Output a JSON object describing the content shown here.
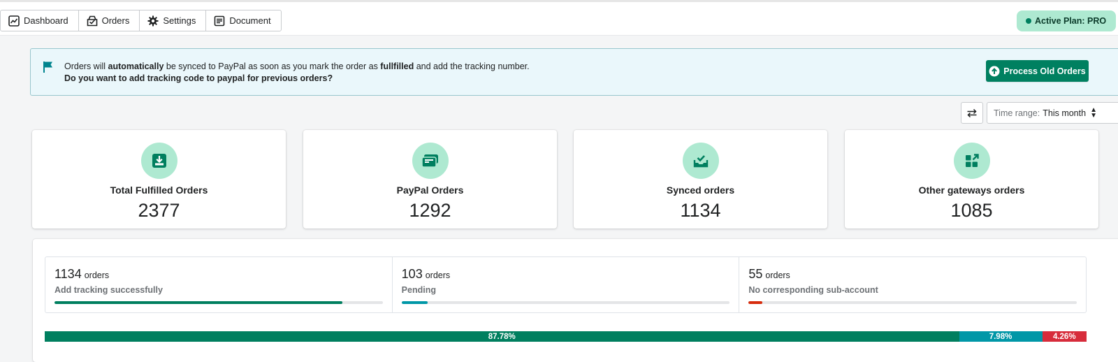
{
  "nav": {
    "items": [
      {
        "label": "Dashboard",
        "icon": "dashboard-icon"
      },
      {
        "label": "Orders",
        "icon": "orders-icon"
      },
      {
        "label": "Settings",
        "icon": "gear-icon"
      },
      {
        "label": "Document",
        "icon": "document-icon"
      }
    ]
  },
  "plan": {
    "label": "Active Plan: PRO"
  },
  "banner": {
    "line1_pre": "Orders will ",
    "line1_b1": "automatically",
    "line1_mid": " be synced to PayPal as soon as you mark the order as ",
    "line1_b2": "fullfilled",
    "line1_post": " and add the tracking number.",
    "line2": "Do you want to add tracking code to paypal for previous orders?",
    "button_label": "Process Old Orders"
  },
  "filters": {
    "time_range_label": "Time range:",
    "time_range_value": "This month"
  },
  "cards": [
    {
      "title": "Total Fulfilled Orders",
      "value": "2377",
      "icon": "download-tray-icon"
    },
    {
      "title": "PayPal Orders",
      "value": "1292",
      "icon": "paypal-card-icon"
    },
    {
      "title": "Synced orders",
      "value": "1134",
      "icon": "synced-tray-icon"
    },
    {
      "title": "Other gateways orders",
      "value": "1085",
      "icon": "apps-icon"
    }
  ],
  "stats": [
    {
      "count": "1134",
      "unit": "orders",
      "desc": "Add tracking successfully",
      "progress": 0.8778,
      "color": "#007f5f"
    },
    {
      "count": "103",
      "unit": "orders",
      "desc": "Pending",
      "progress": 0.0798,
      "color": "#0097a7"
    },
    {
      "count": "55",
      "unit": "orders",
      "desc": "No corresponding sub-account",
      "progress": 0.0426,
      "color": "#d72c0d"
    }
  ],
  "distribution": [
    {
      "label": "87.78%",
      "fraction": 0.8778,
      "color": "#007f5f"
    },
    {
      "label": "7.98%",
      "fraction": 0.0798,
      "color": "#0097a7"
    },
    {
      "label": "4.26%",
      "fraction": 0.0426,
      "color": "#d72c3b"
    }
  ],
  "colors": {
    "accent": "#008060",
    "icon_bg": "#aee9d1"
  }
}
